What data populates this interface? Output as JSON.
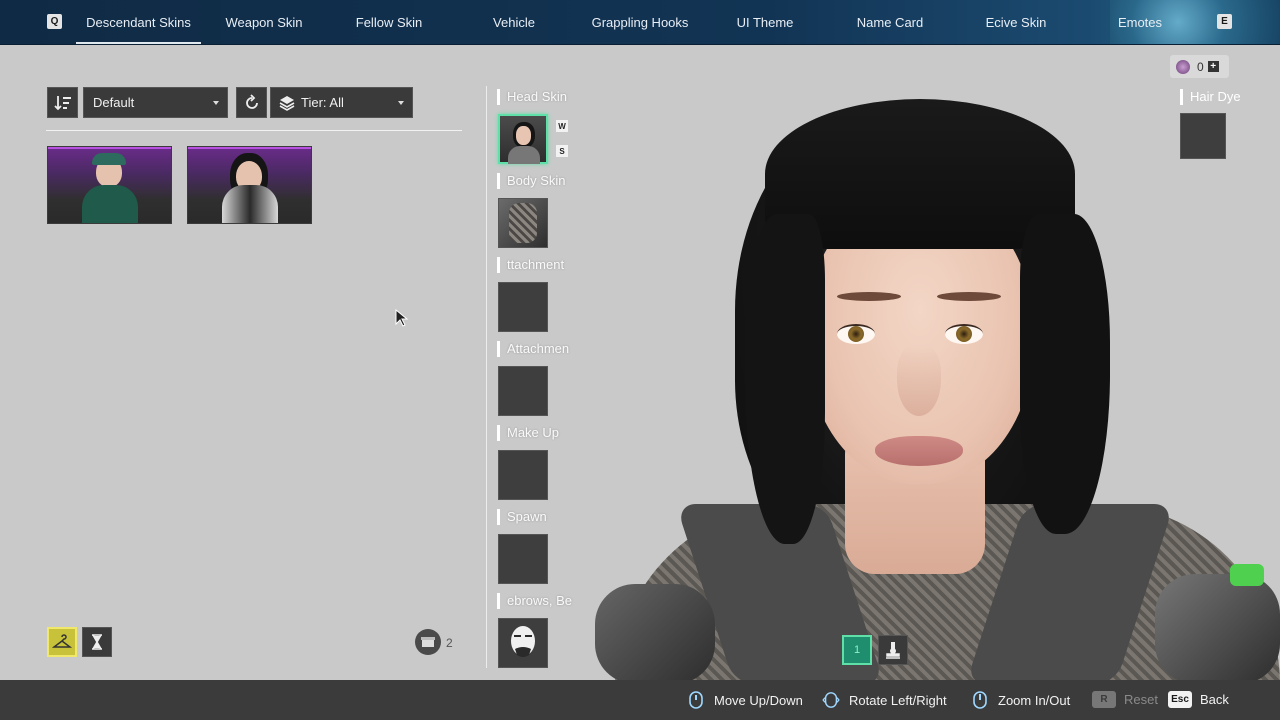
{
  "topbar": {
    "left_key": "Q",
    "right_key": "E",
    "tabs": [
      {
        "label": "Descendant Skins",
        "active": true
      },
      {
        "label": "Weapon Skin"
      },
      {
        "label": "Fellow Skin"
      },
      {
        "label": "Vehicle"
      },
      {
        "label": "Grappling Hooks"
      },
      {
        "label": "UI Theme"
      },
      {
        "label": "Name Card"
      },
      {
        "label": "Ecive Skin"
      },
      {
        "label": "Emotes"
      }
    ]
  },
  "toolbar": {
    "sort_value": "Default",
    "tier_value": "Tier: All"
  },
  "skins_grid": {
    "count": "2",
    "items": [
      {
        "name": "skin-card-1",
        "rarity_color": "#b74fe0"
      },
      {
        "name": "skin-card-2",
        "rarity_color": "#b74fe0"
      }
    ]
  },
  "slots": [
    {
      "label": "Head Skin",
      "keys": [
        "W",
        "S"
      ]
    },
    {
      "label": "Body Skin"
    },
    {
      "label": "ttachment"
    },
    {
      "label": "Attachmen"
    },
    {
      "label": "Make Up"
    },
    {
      "label": "Spawn"
    },
    {
      "label": "ebrows, Be"
    }
  ],
  "currency": {
    "amount": "0",
    "plus": "+"
  },
  "hair_dye": {
    "label": "Hair Dye"
  },
  "view_buttons": [
    {
      "label": "1"
    }
  ],
  "hints": [
    {
      "label": "Move Up/Down",
      "icon": "mouse-scroll-icon"
    },
    {
      "label": "Rotate Left/Right",
      "icon": "mouse-drag-icon"
    },
    {
      "label": "Zoom In/Out",
      "icon": "mouse-wheel-icon"
    },
    {
      "label": "Reset",
      "key": "R",
      "disabled": true
    },
    {
      "label": "Back",
      "key": "Esc"
    }
  ],
  "colors": {
    "selected_slot": "#5fe0a8",
    "active_mode": "#c8c23a",
    "rarity_purple": "#b74fe0"
  }
}
